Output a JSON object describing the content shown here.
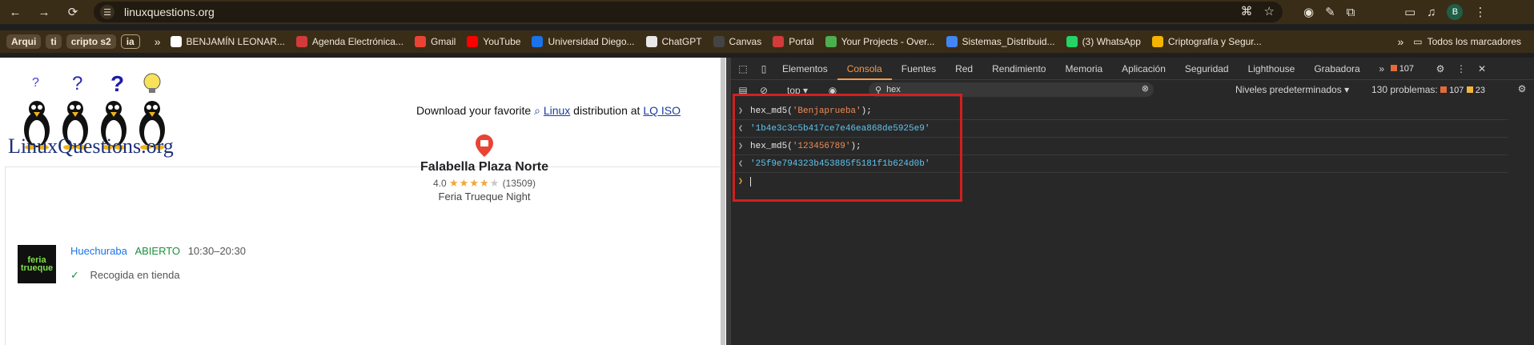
{
  "browser": {
    "url": "linuxquestions.org",
    "avatar_letter": "B"
  },
  "bookmarks": {
    "chips": [
      "Arqui",
      "ti",
      "cripto s2",
      "ia"
    ],
    "items": [
      {
        "label": "BENJAMÍN LEONAR...",
        "icon": "notion-icon",
        "color": "#ffffff"
      },
      {
        "label": "Agenda Electrónica...",
        "icon": "udp-icon",
        "color": "#d23b3b"
      },
      {
        "label": "Gmail",
        "icon": "gmail-icon",
        "color": "#ea4335"
      },
      {
        "label": "YouTube",
        "icon": "youtube-icon",
        "color": "#ff0000"
      },
      {
        "label": "Universidad Diego...",
        "icon": "calendar-icon",
        "color": "#1a73e8"
      },
      {
        "label": "ChatGPT",
        "icon": "chatgpt-icon",
        "color": "#e8e8e8"
      },
      {
        "label": "Canvas",
        "icon": "canvas-icon",
        "color": "#444444"
      },
      {
        "label": "Portal",
        "icon": "udp-icon",
        "color": "#d23b3b"
      },
      {
        "label": "Your Projects - Over...",
        "icon": "overleaf-icon",
        "color": "#4caf50"
      },
      {
        "label": "Sistemas_Distribuid...",
        "icon": "google-icon",
        "color": "#4285f4"
      },
      {
        "label": "(3) WhatsApp",
        "icon": "whatsapp-icon",
        "color": "#25d366"
      },
      {
        "label": "Criptografía y Segur...",
        "icon": "drive-icon",
        "color": "#f4b400"
      }
    ],
    "all_bookmarks": "Todos los marcadores"
  },
  "page": {
    "site_name": "LinuxQuestions.org",
    "download_prefix": "Download your favorite",
    "download_link": "Linux",
    "download_mid": "distribution at",
    "download_link2": "LQ ISO",
    "store_name": "Falabella Plaza Norte",
    "rating_value": "4.0",
    "rating_stars": 4,
    "rating_count": "(13509)",
    "store_subtitle": "Feria Trueque Night",
    "thumb_text": "feria trueque",
    "branch_name": "Huechuraba",
    "branch_status": "ABIERTO",
    "branch_hours": "10:30–20:30",
    "pickup": "Recogida en tienda"
  },
  "devtools": {
    "tabs": [
      "Elementos",
      "Consola",
      "Fuentes",
      "Red",
      "Rendimiento",
      "Memoria",
      "Aplicación",
      "Seguridad",
      "Lighthouse",
      "Grabadora"
    ],
    "active_tab": "Consola",
    "error_count": "107",
    "context": "top",
    "filter": "hex",
    "levels": "Niveles predeterminados",
    "problems_label": "130 problemas:",
    "problems_errors": "107",
    "problems_warnings": "23",
    "console": [
      {
        "type": "input",
        "fn": "hex_md5(",
        "arg": "'Benjaprueba'",
        "tail": ");"
      },
      {
        "type": "result",
        "value": "'1b4e3c3c5b417ce7e46ea868de5925e9'"
      },
      {
        "type": "input",
        "fn": "hex_md5(",
        "arg": "'123456789'",
        "tail": ");"
      },
      {
        "type": "result",
        "value": "'25f9e794323b453885f5181f1b624d0b'"
      }
    ]
  }
}
